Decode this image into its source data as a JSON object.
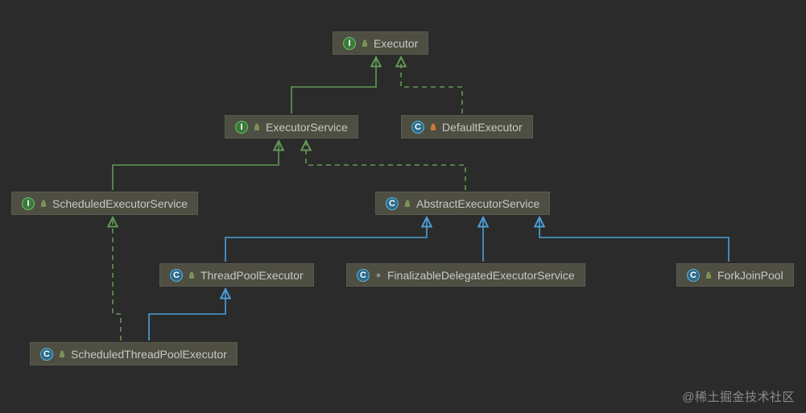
{
  "diagram": {
    "nodes": {
      "executor": {
        "kind": "I",
        "vis": "public",
        "label": "Executor"
      },
      "executorService": {
        "kind": "I",
        "vis": "public",
        "label": "ExecutorService"
      },
      "defaultExecutor": {
        "kind": "C",
        "vis": "private",
        "label": "DefaultExecutor"
      },
      "scheduledExecSvc": {
        "kind": "I",
        "vis": "public",
        "label": "ScheduledExecutorService"
      },
      "abstractExecSvc": {
        "kind": "C",
        "vis": "public",
        "label": "AbstractExecutorService"
      },
      "threadPoolExec": {
        "kind": "C",
        "vis": "public",
        "label": "ThreadPoolExecutor"
      },
      "finalizableDelegated": {
        "kind": "C",
        "vis": "package",
        "label": "FinalizableDelegatedExecutorService"
      },
      "forkJoinPool": {
        "kind": "C",
        "vis": "public",
        "label": "ForkJoinPool"
      },
      "scheduledTPExec": {
        "kind": "C",
        "vis": "public",
        "label": "ScheduledThreadPoolExecutor"
      }
    },
    "edges": [
      {
        "from": "executorService",
        "to": "executor",
        "type": "implements"
      },
      {
        "from": "defaultExecutor",
        "to": "executor",
        "type": "implements"
      },
      {
        "from": "scheduledExecSvc",
        "to": "executorService",
        "type": "implements"
      },
      {
        "from": "abstractExecSvc",
        "to": "executorService",
        "type": "implements"
      },
      {
        "from": "threadPoolExec",
        "to": "abstractExecSvc",
        "type": "extends"
      },
      {
        "from": "finalizableDelegated",
        "to": "abstractExecSvc",
        "type": "extends"
      },
      {
        "from": "forkJoinPool",
        "to": "abstractExecSvc",
        "type": "extends"
      },
      {
        "from": "scheduledTPExec",
        "to": "threadPoolExec",
        "type": "extends"
      },
      {
        "from": "scheduledTPExec",
        "to": "scheduledExecSvc",
        "type": "implements"
      }
    ]
  },
  "icons": {
    "I": "I",
    "C": "C"
  },
  "colors": {
    "implements": "#629755",
    "extends": "#4a9fd8",
    "lockPublic": "#7a915a",
    "lockPrivate": "#c57b3d",
    "lockPackage": "#888888"
  },
  "watermark": "@稀土掘金技术社区"
}
